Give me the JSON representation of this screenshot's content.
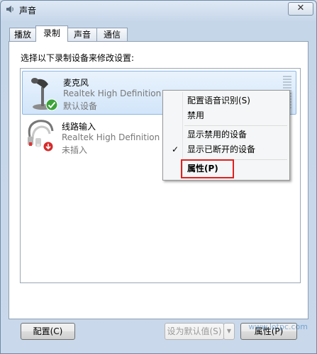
{
  "window": {
    "title": "声音",
    "close_symbol": "✕"
  },
  "tabs": [
    {
      "label": "播放",
      "active": false
    },
    {
      "label": "录制",
      "active": true
    },
    {
      "label": "声音",
      "active": false
    },
    {
      "label": "通信",
      "active": false
    }
  ],
  "panel": {
    "instruction": "选择以下录制设备来修改设置:"
  },
  "devices": [
    {
      "name": "麦克风",
      "description": "Realtek High Definition Au",
      "status": "默认设备",
      "selected": true,
      "icon": "microphone-icon",
      "badge": "green-check-icon"
    },
    {
      "name": "线路输入",
      "description": "Realtek High Definition Au",
      "status": "未插入",
      "selected": false,
      "icon": "line-in-cable-icon",
      "badge": "red-down-arrow-icon"
    }
  ],
  "context_menu": {
    "items": [
      {
        "label": "配置语音识别(S)",
        "checked": false
      },
      {
        "label": "禁用",
        "checked": false
      },
      {
        "label": "显示禁用的设备",
        "checked": false
      },
      {
        "label": "显示已断开的设备",
        "checked": true
      },
      {
        "label": "属性(P)",
        "checked": false,
        "bold": true,
        "highlighted": true
      }
    ],
    "check_symbol": "✓"
  },
  "buttons": {
    "configure": "配置(C)",
    "set_default": "设为默认值(S)",
    "dropdown_arrow": "▼",
    "properties": "属性(P)"
  },
  "watermark": "www.lotpc.com",
  "colors": {
    "highlight_border": "#e01f1f",
    "selection_bg": "#d2e5fa",
    "window_frame": "#c9d8ea"
  }
}
